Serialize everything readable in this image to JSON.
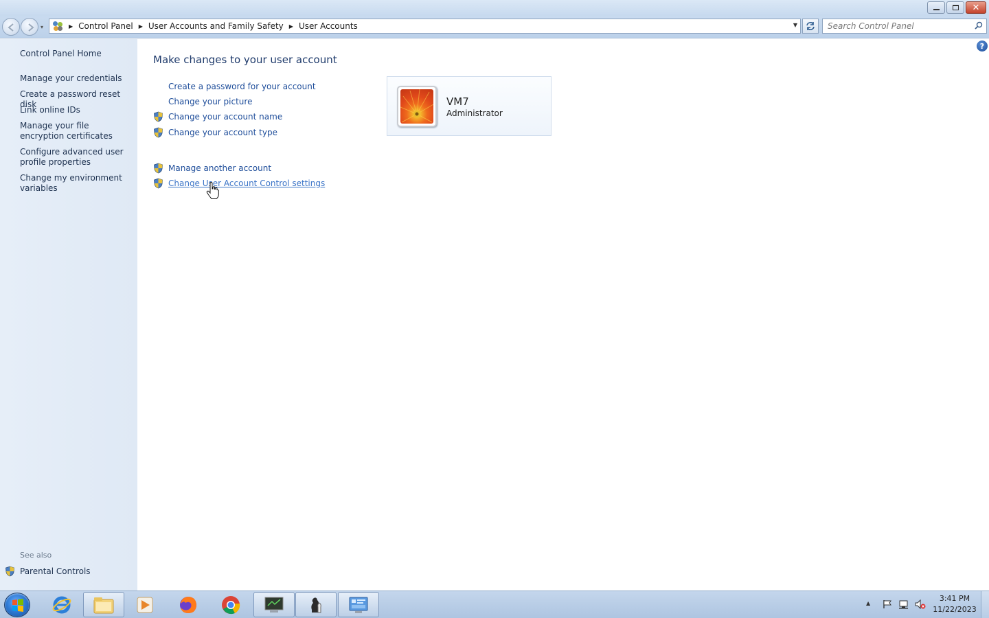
{
  "window": {
    "minimize_icon": "minimize-icon",
    "maximize_icon": "restore-icon",
    "close_icon": "close-icon"
  },
  "address": {
    "crumbs": [
      "Control Panel",
      "User Accounts and Family Safety",
      "User Accounts"
    ]
  },
  "search": {
    "placeholder": "Search Control Panel"
  },
  "sidebar": {
    "home": "Control Panel Home",
    "links": [
      "Manage your credentials",
      "Create a password reset disk",
      "Link online IDs",
      "Manage your file encryption certificates",
      "Configure advanced user profile properties",
      "Change my environment variables"
    ],
    "see_also_label": "See also",
    "see_also_links": [
      "Parental Controls"
    ]
  },
  "main": {
    "title": "Make changes to your user account",
    "tasks": [
      {
        "label": "Create a password for your account",
        "shield": false
      },
      {
        "label": "Change your picture",
        "shield": false
      },
      {
        "label": "Change your account name",
        "shield": true
      },
      {
        "label": "Change your account type",
        "shield": true
      }
    ],
    "tasks2": [
      {
        "label": "Manage another account",
        "shield": true
      },
      {
        "label": "Change User Account Control settings",
        "shield": true,
        "hovered": true
      }
    ],
    "account": {
      "name": "VM7",
      "role": "Administrator"
    }
  },
  "taskbar": {
    "apps": [
      "start-orb",
      "internet-explorer-icon",
      "file-explorer-icon",
      "media-player-icon",
      "firefox-icon",
      "chrome-icon",
      "terminal-icon",
      "chess-icon",
      "control-panel-icon"
    ],
    "clock_time": "3:41 PM",
    "clock_date": "11/22/2023"
  },
  "colors": {
    "link": "#1e4d9a",
    "title": "#1e3a6b",
    "sidebar_bg": "#e3ecf7"
  }
}
